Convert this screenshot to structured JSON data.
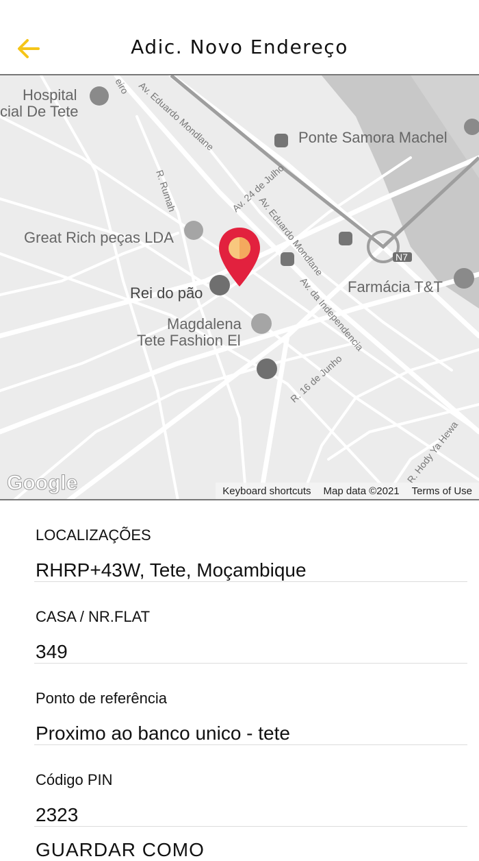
{
  "header": {
    "title": "Adic. Novo Endereço"
  },
  "colors": {
    "accent": "#F5C518",
    "pin_top": "#FF2D55",
    "pin_center": "#F8C77E"
  },
  "map": {
    "labels": {
      "hospital": "Hospital",
      "hospital2": "cial De Tete",
      "ponte": "Ponte Samora Machel",
      "great_rich": "Great Rich peças LDA",
      "rei": "Rei do pão",
      "magdalena1": "Magdalena",
      "magdalena2": "Tete Fashion El",
      "farmacia": "Farmácia T&T",
      "av_mondlane_top": "Av. Eduardo Mondlane",
      "av_24": "Av. 24 de Julho",
      "av_mondlane_mid": "Av. Eduardo Mondlane",
      "av_independencia": "Av. da Independencia",
      "r_rumah": "R. Rumah",
      "r_16": "R. 16 de Junho",
      "r_hody": "R. Hody Ya Hewa",
      "n7": "N7",
      "eiro": "eiro"
    },
    "google": "Google",
    "attribution": {
      "shortcuts": "Keyboard shortcuts",
      "mapdata": "Map data ©2021",
      "terms": "Terms of Use"
    }
  },
  "form": {
    "location_label": "LOCALIZAÇÕES",
    "location_value": "RHRP+43W, Tete, Moçambique",
    "house_label": "CASA / NR.FLAT",
    "house_value": "349",
    "ref_label": "Ponto de referência",
    "ref_value": "Proximo ao banco unico - tete",
    "pin_label": "Código PIN",
    "pin_value": "2323",
    "save_as_label": "GUARDAR COMO"
  }
}
